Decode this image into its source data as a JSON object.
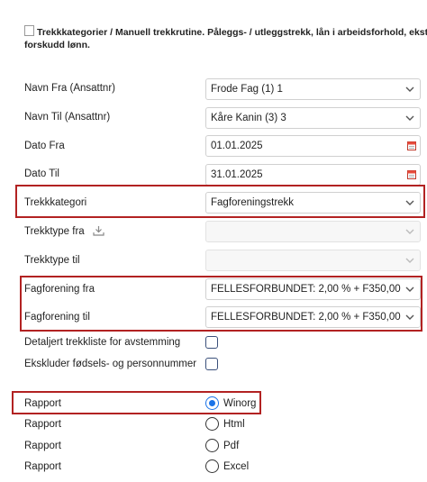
{
  "header": {
    "title_line1": "Trekkkategorier / Manuell trekkrutine. Påleggs- / utleggstrekk, lån i arbeidsforhold, ekstr",
    "title_line2": "forskudd lønn."
  },
  "form": {
    "navn_fra": {
      "label": "Navn Fra (Ansattnr)",
      "value": "Frode Fag (1) 1"
    },
    "navn_til": {
      "label": "Navn Til (Ansattnr)",
      "value": "Kåre Kanin (3) 3"
    },
    "dato_fra": {
      "label": "Dato Fra",
      "value": "01.01.2025"
    },
    "dato_til": {
      "label": "Dato Til",
      "value": "31.01.2025"
    },
    "trekkkategori": {
      "label": "Trekkkategori",
      "value": "Fagforeningstrekk"
    },
    "trekktype_fra": {
      "label": "Trekktype fra",
      "value": ""
    },
    "trekktype_til": {
      "label": "Trekktype til",
      "value": ""
    },
    "fagforening_fra": {
      "label": "Fagforening fra",
      "value": "FELLESFORBUNDET: 2,00 % + F350,00"
    },
    "fagforening_til": {
      "label": "Fagforening til",
      "value": "FELLESFORBUNDET: 2,00 % + F350,00"
    },
    "detaljert": {
      "label": "Detaljert trekkliste for avstemming",
      "checked": false
    },
    "ekskluder": {
      "label": "Ekskluder fødsels- og personnummer",
      "checked": false
    }
  },
  "rapport": {
    "options": [
      {
        "row_label": "Rapport",
        "option": "Winorg",
        "checked": true
      },
      {
        "row_label": "Rapport",
        "option": "Html",
        "checked": false
      },
      {
        "row_label": "Rapport",
        "option": "Pdf",
        "checked": false
      },
      {
        "row_label": "Rapport",
        "option": "Excel",
        "checked": false
      }
    ]
  },
  "colors": {
    "highlight": "#b22222",
    "radio_accent": "#1a73e8"
  }
}
